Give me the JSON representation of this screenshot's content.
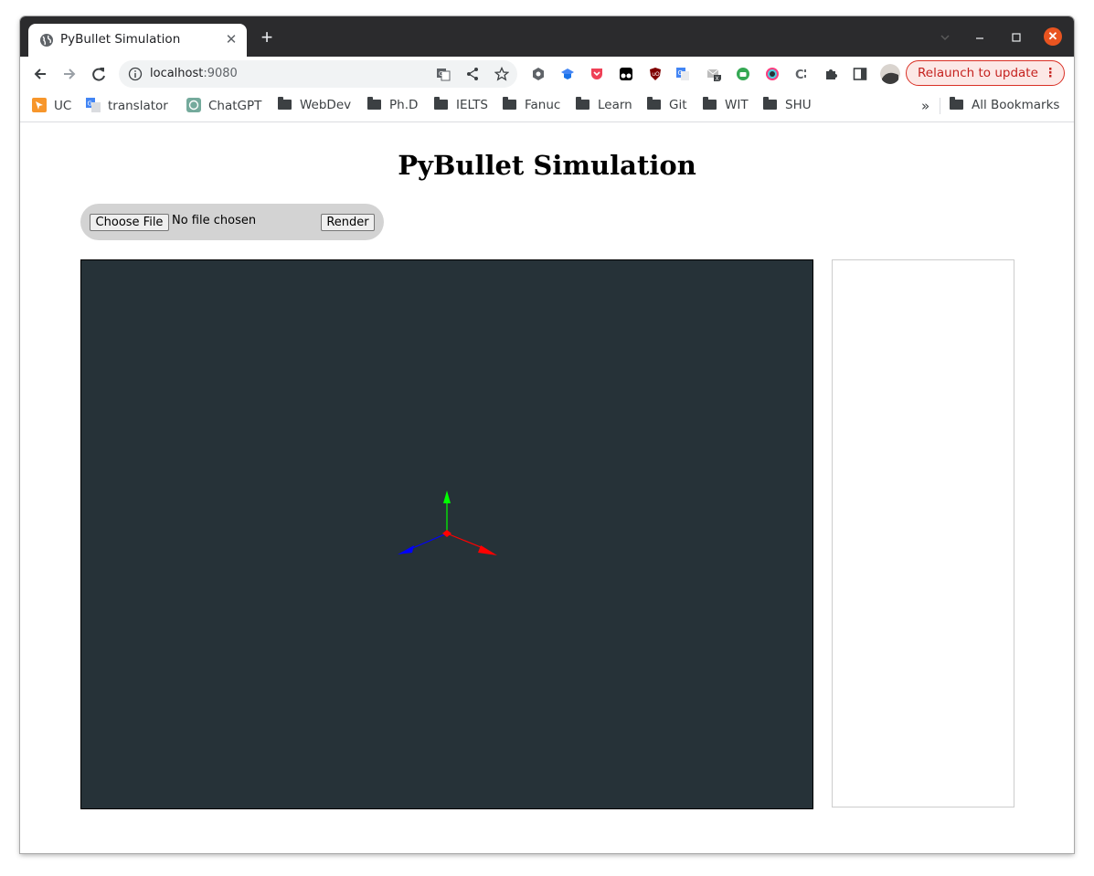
{
  "browser": {
    "tab_title": "PyBullet Simulation",
    "new_tab_symbol": "+",
    "url_host": "localhost",
    "url_port": ":9080",
    "relaunch_label": "Relaunch to update",
    "bookmarks": [
      "UC",
      "translator",
      "ChatGPT",
      "WebDev",
      "Ph.D",
      "IELTS",
      "Fanuc",
      "Learn",
      "Git",
      "WIT",
      "SHU"
    ],
    "overflow_symbol": "»",
    "all_bookmarks_label": "All Bookmarks"
  },
  "page": {
    "heading": "PyBullet Simulation",
    "choose_file_label": "Choose File",
    "file_status": "No file chosen",
    "render_label": "Render"
  },
  "viewer": {
    "background_color": "#263238",
    "axes": {
      "x_color": "#ff0000",
      "y_color": "#00ff00",
      "z_color": "#0000ff"
    }
  }
}
